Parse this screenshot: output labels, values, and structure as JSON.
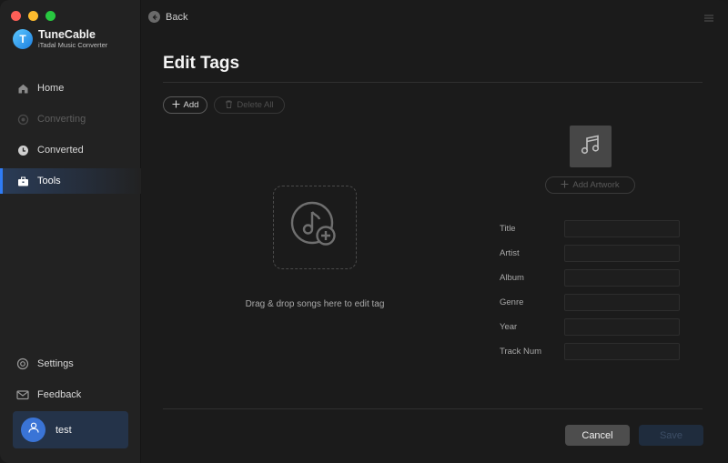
{
  "app": {
    "name": "TuneCable",
    "subtitle": "iTadal Music Converter",
    "logo_glyph": "T"
  },
  "sidebar": {
    "items": [
      {
        "label": "Home",
        "icon": "home-icon",
        "state": "normal"
      },
      {
        "label": "Converting",
        "icon": "converting-icon",
        "state": "disabled"
      },
      {
        "label": "Converted",
        "icon": "clock-icon",
        "state": "normal"
      },
      {
        "label": "Tools",
        "icon": "toolbox-icon",
        "state": "active"
      }
    ],
    "bottom_items": [
      {
        "label": "Settings",
        "icon": "settings-icon"
      },
      {
        "label": "Feedback",
        "icon": "mail-icon"
      }
    ],
    "user": {
      "name": "test"
    }
  },
  "header": {
    "back_label": "Back"
  },
  "main": {
    "title": "Edit Tags",
    "add_label": "Add",
    "delete_all_label": "Delete All",
    "drop_text": "Drag & drop songs here to edit tag",
    "add_artwork_label": "Add Artwork",
    "fields": [
      {
        "label": "Title",
        "value": ""
      },
      {
        "label": "Artist",
        "value": ""
      },
      {
        "label": "Album",
        "value": ""
      },
      {
        "label": "Genre",
        "value": ""
      },
      {
        "label": "Year",
        "value": ""
      },
      {
        "label": "Track Num",
        "value": ""
      }
    ],
    "cancel_label": "Cancel",
    "save_label": "Save"
  },
  "colors": {
    "accent": "#2f7cf6",
    "sidebar_bg": "#222222",
    "main_bg": "#1b1b1b"
  }
}
